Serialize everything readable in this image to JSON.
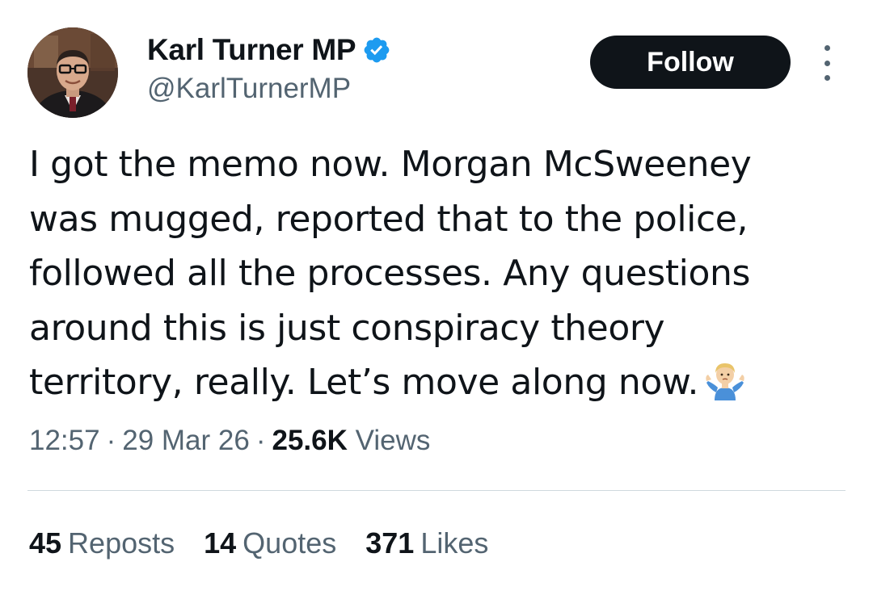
{
  "author": {
    "display_name": "Karl Turner MP",
    "handle": "@KarlTurnerMP",
    "verified": true,
    "avatar_icon": "profile-photo"
  },
  "actions": {
    "follow_label": "Follow",
    "more_icon": "more-vertical-icon"
  },
  "tweet": {
    "lines": [
      "I got the memo now. Morgan McSweeney",
      "was mugged, reported that to the police,",
      "followed all the processes. Any questions",
      "around this is just conspiracy theory",
      "territory, really. Let’s move along now."
    ],
    "emoji": "person-shrugging-emoji"
  },
  "meta": {
    "time": "12:57",
    "separator": "·",
    "date": "29 Mar 26",
    "views_count": "25.6K",
    "views_label": "Views"
  },
  "stats": {
    "reposts_count": "45",
    "reposts_label": "Reposts",
    "quotes_count": "14",
    "quotes_label": "Quotes",
    "likes_count": "371",
    "likes_label": "Likes"
  },
  "colors": {
    "text_primary": "#0f1419",
    "text_secondary": "#536471",
    "verified_blue": "#1d9bf0",
    "divider": "#cfd9de",
    "follow_bg": "#0f1419"
  }
}
